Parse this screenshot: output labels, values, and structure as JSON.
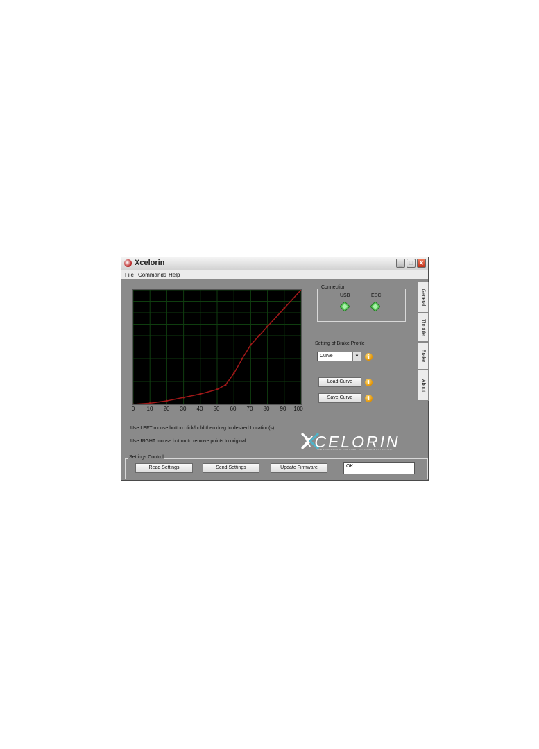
{
  "window": {
    "title": "Xcelorin",
    "minimize_icon": "minimize-icon",
    "maximize_icon": "maximize-icon",
    "close_icon": "close-icon",
    "minimize_glyph": "_",
    "maximize_glyph": "□",
    "close_glyph": "✕"
  },
  "menu": {
    "items": [
      "File",
      "Commands",
      "Help"
    ]
  },
  "curve": {
    "x_ticks": [
      "0",
      "10",
      "20",
      "30",
      "40",
      "50",
      "60",
      "70",
      "80",
      "90",
      "100"
    ],
    "xlim": [
      0,
      100
    ],
    "ylim": [
      0,
      100
    ],
    "grid": true,
    "points": [
      [
        0,
        0
      ],
      [
        10,
        1
      ],
      [
        20,
        3
      ],
      [
        30,
        6
      ],
      [
        40,
        9
      ],
      [
        50,
        13
      ],
      [
        55,
        17
      ],
      [
        60,
        27
      ],
      [
        65,
        40
      ],
      [
        70,
        52
      ],
      [
        75,
        60
      ],
      [
        80,
        68
      ],
      [
        90,
        84
      ],
      [
        100,
        100
      ]
    ],
    "background_color": "#000000",
    "grid_color": "#0f3d0f",
    "line_color": "#a01818"
  },
  "hints": {
    "left": "Use LEFT mouse button click/hold then drag to desired Location(s)",
    "right": "Use RIGHT mouse button to remove points to original"
  },
  "connection": {
    "legend": "Connection",
    "usb_label": "USB",
    "esc_label": "ESC",
    "status_icon": "connection-ok-icon",
    "status_color": "#5ccc5c"
  },
  "profile": {
    "label": "Setting of Brake Profile",
    "selected": "Curve",
    "arrow": "▼"
  },
  "buttons": {
    "load_curve": "Load Curve",
    "save_curve": "Save Curve",
    "info_glyph": "i"
  },
  "tabs": [
    "General",
    "Throttle",
    "Brake",
    "About"
  ],
  "logo": {
    "text": "XCELORIN",
    "tagline": "THE POWERHOUSE FOR EVERY PASSIONATE ENTHUSIAST"
  },
  "settings_control": {
    "legend": "Settings Control",
    "read": "Read Settings",
    "send": "Send Settings",
    "update": "Update Firmware",
    "status": "OK"
  }
}
